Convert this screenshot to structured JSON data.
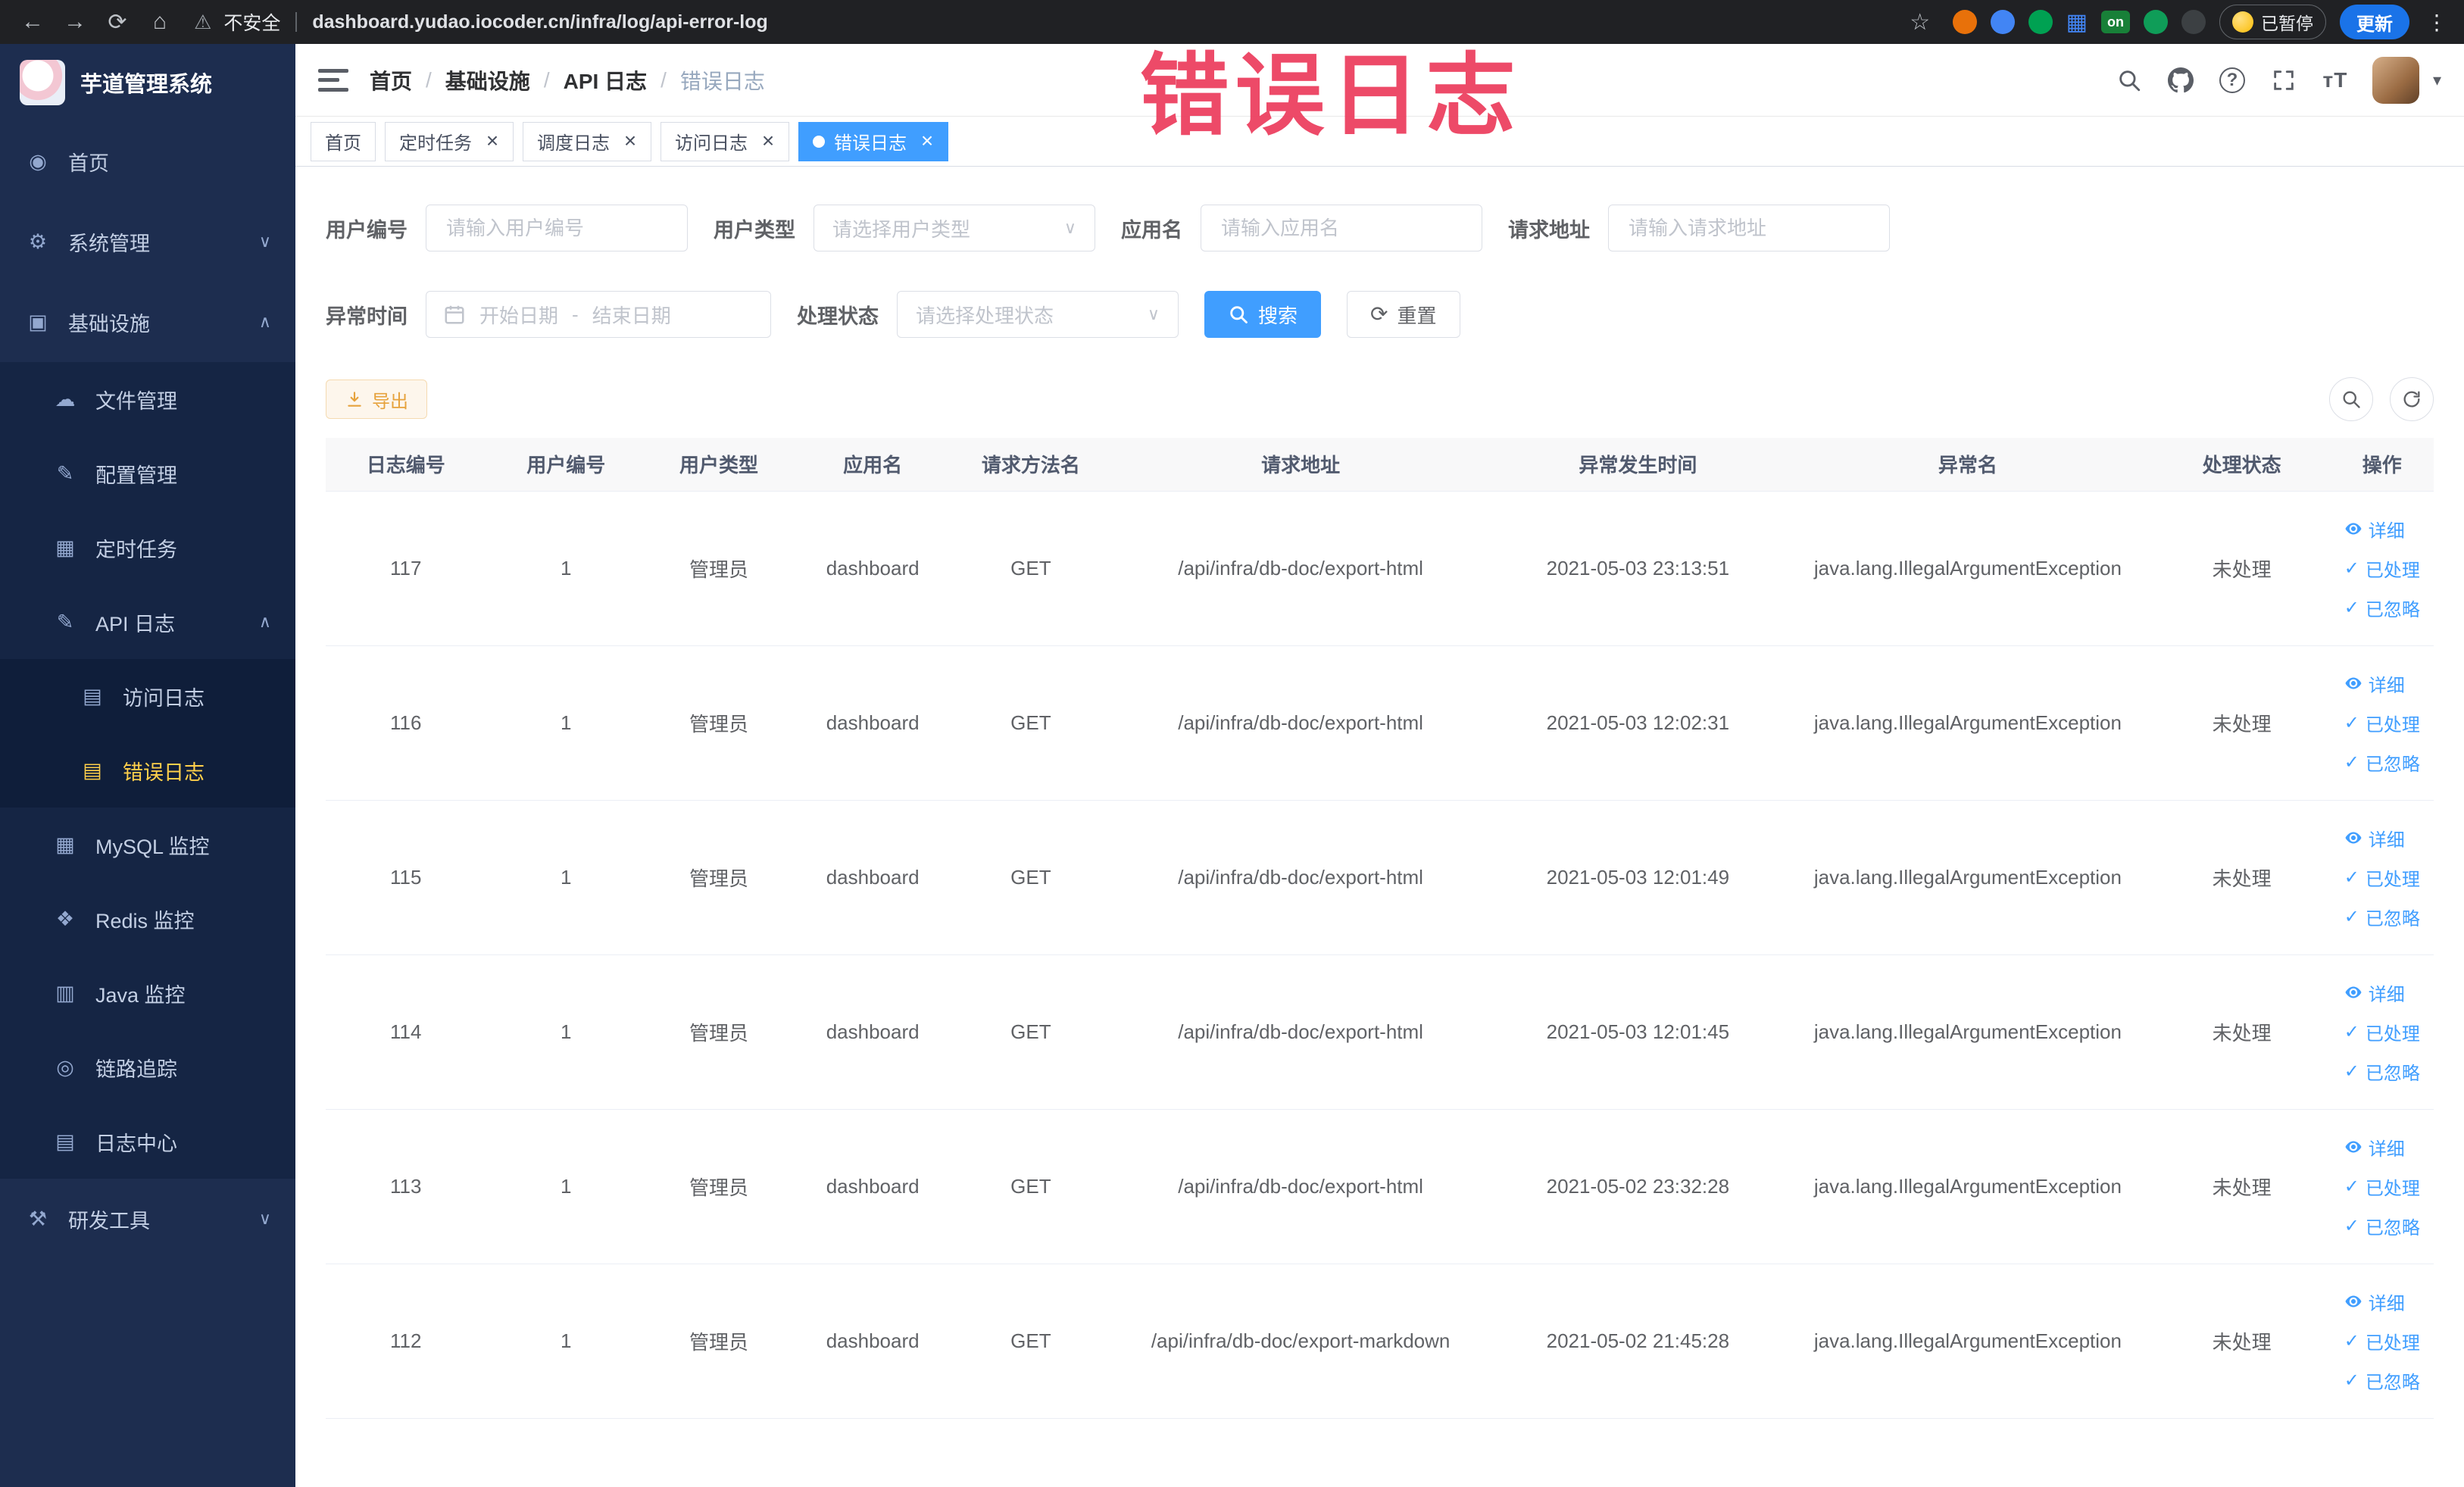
{
  "browser": {
    "security_label": "不安全",
    "url": "dashboard.yudao.iocoder.cn/infra/log/api-error-log",
    "extension_on_label": "on",
    "paused_label": "已暂停",
    "update_label": "更新"
  },
  "watermark": "错误日志",
  "icons": {
    "back": "←",
    "forward": "→",
    "reload": "⟳",
    "home": "⌂",
    "warning": "⚠",
    "star": "☆",
    "kebab": "⋮",
    "grid": "▦",
    "help": "?",
    "font_size": "тT",
    "caret_down": "▾",
    "reset_glyph": "⟳",
    "check": "✓",
    "close": "×",
    "select_caret": "∨"
  },
  "sidebar": {
    "title": "芋道管理系统",
    "menu": [
      {
        "label": "首页",
        "icon": "dashboard",
        "level": 1
      },
      {
        "label": "系统管理",
        "icon": "gear",
        "level": 1,
        "chevron": "down"
      },
      {
        "label": "基础设施",
        "icon": "infra",
        "level": 1,
        "chevron": "up"
      },
      {
        "label": "文件管理",
        "icon": "file",
        "level": 2
      },
      {
        "label": "配置管理",
        "icon": "config",
        "level": 2
      },
      {
        "label": "定时任务",
        "icon": "job",
        "level": 2
      },
      {
        "label": "API 日志",
        "icon": "api-log",
        "level": 2,
        "chevron": "up"
      },
      {
        "label": "访问日志",
        "icon": "doc",
        "level": 3
      },
      {
        "label": "错误日志",
        "icon": "doc",
        "level": 3,
        "active": true
      },
      {
        "label": "MySQL 监控",
        "icon": "mysql",
        "level": 2
      },
      {
        "label": "Redis 监控",
        "icon": "redis",
        "level": 2
      },
      {
        "label": "Java 监控",
        "icon": "java",
        "level": 2
      },
      {
        "label": "链路追踪",
        "icon": "trace",
        "level": 2
      },
      {
        "label": "日志中心",
        "icon": "log-center",
        "level": 2
      },
      {
        "label": "研发工具",
        "icon": "tools",
        "level": 1,
        "chevron": "down"
      }
    ]
  },
  "header": {
    "breadcrumb": [
      "首页",
      "基础设施",
      "API 日志",
      "错误日志"
    ],
    "separator": "/"
  },
  "tabs": [
    {
      "label": "首页",
      "closable": false,
      "active": false
    },
    {
      "label": "定时任务",
      "closable": true,
      "active": false
    },
    {
      "label": "调度日志",
      "closable": true,
      "active": false
    },
    {
      "label": "访问日志",
      "closable": true,
      "active": false
    },
    {
      "label": "错误日志",
      "closable": true,
      "active": true
    }
  ],
  "filters": {
    "user_id": {
      "label": "用户编号",
      "placeholder": "请输入用户编号"
    },
    "user_type": {
      "label": "用户类型",
      "placeholder": "请选择用户类型"
    },
    "app_name": {
      "label": "应用名",
      "placeholder": "请输入应用名"
    },
    "request_url": {
      "label": "请求地址",
      "placeholder": "请输入请求地址"
    },
    "exception_time": {
      "label": "异常时间",
      "start_placeholder": "开始日期",
      "separator": "-",
      "end_placeholder": "结束日期"
    },
    "process_status": {
      "label": "处理状态",
      "placeholder": "请选择处理状态"
    },
    "search_label": "搜索",
    "reset_label": "重置"
  },
  "toolbar": {
    "export_label": "导出"
  },
  "table": {
    "columns": [
      "日志编号",
      "用户编号",
      "用户类型",
      "应用名",
      "请求方法名",
      "请求地址",
      "异常发生时间",
      "异常名",
      "处理状态",
      "操作"
    ],
    "actions": [
      "详细",
      "已处理",
      "已忽略"
    ],
    "rows": [
      {
        "id": "117",
        "user_id": "1",
        "user_type": "管理员",
        "app": "dashboard",
        "method": "GET",
        "url": "/api/infra/db-doc/export-html",
        "time": "2021-05-03 23:13:51",
        "exception": "java.lang.IllegalArgumentException",
        "status": "未处理"
      },
      {
        "id": "116",
        "user_id": "1",
        "user_type": "管理员",
        "app": "dashboard",
        "method": "GET",
        "url": "/api/infra/db-doc/export-html",
        "time": "2021-05-03 12:02:31",
        "exception": "java.lang.IllegalArgumentException",
        "status": "未处理"
      },
      {
        "id": "115",
        "user_id": "1",
        "user_type": "管理员",
        "app": "dashboard",
        "method": "GET",
        "url": "/api/infra/db-doc/export-html",
        "time": "2021-05-03 12:01:49",
        "exception": "java.lang.IllegalArgumentException",
        "status": "未处理"
      },
      {
        "id": "114",
        "user_id": "1",
        "user_type": "管理员",
        "app": "dashboard",
        "method": "GET",
        "url": "/api/infra/db-doc/export-html",
        "time": "2021-05-03 12:01:45",
        "exception": "java.lang.IllegalArgumentException",
        "status": "未处理"
      },
      {
        "id": "113",
        "user_id": "1",
        "user_type": "管理员",
        "app": "dashboard",
        "method": "GET",
        "url": "/api/infra/db-doc/export-html",
        "time": "2021-05-02 23:32:28",
        "exception": "java.lang.IllegalArgumentException",
        "status": "未处理"
      },
      {
        "id": "112",
        "user_id": "1",
        "user_type": "管理员",
        "app": "dashboard",
        "method": "GET",
        "url": "/api/infra/db-doc/export-markdown",
        "time": "2021-05-02 21:45:28",
        "exception": "java.lang.IllegalArgumentException",
        "status": "未处理"
      }
    ]
  }
}
